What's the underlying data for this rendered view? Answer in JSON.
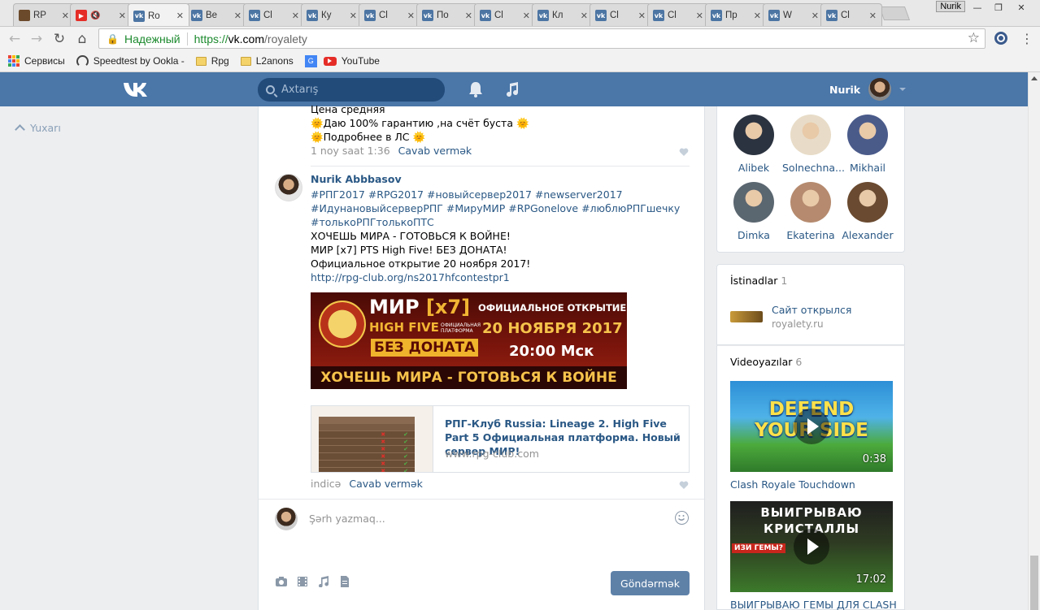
{
  "browser": {
    "tabs": [
      {
        "title": "RP",
        "favicon": "rp"
      },
      {
        "title": "",
        "favicon": "yt",
        "muted": true
      },
      {
        "title": "Ro",
        "favicon": "vk",
        "active": true
      },
      {
        "title": "Be",
        "favicon": "vk"
      },
      {
        "title": "Cl",
        "favicon": "vk"
      },
      {
        "title": "Ку",
        "favicon": "vk"
      },
      {
        "title": "Cl",
        "favicon": "vk"
      },
      {
        "title": "По",
        "favicon": "vk"
      },
      {
        "title": "Cl",
        "favicon": "vk"
      },
      {
        "title": "Кл",
        "favicon": "vk"
      },
      {
        "title": "Cl",
        "favicon": "vk"
      },
      {
        "title": "Cl",
        "favicon": "vk"
      },
      {
        "title": "Пр",
        "favicon": "vk"
      },
      {
        "title": "W",
        "favicon": "vk"
      },
      {
        "title": "Cl",
        "favicon": "vk"
      }
    ],
    "profile_badge": "Nurik",
    "secure_label": "Надежный",
    "url_scheme": "https://",
    "url_host": "vk.com",
    "url_path": "/royalety",
    "bookmarks": [
      {
        "label": "Сервисы",
        "icon": "apps-grid-icon"
      },
      {
        "label": "Speedtest by Ookla - Th",
        "icon": "speedometer-icon"
      },
      {
        "label": "Rpg",
        "icon": "folder-icon"
      },
      {
        "label": "L2anons",
        "icon": "folder-icon"
      },
      {
        "label": "",
        "icon": "google-translate-icon"
      },
      {
        "label": "YouTube",
        "icon": "youtube-icon"
      }
    ]
  },
  "vk": {
    "search_placeholder": "Axtarış",
    "user_name": "Nurik",
    "back_to_top": "Yuxarı"
  },
  "post1": {
    "lines": [
      "Цена средняя",
      "🌞Даю 100% гарантию ,на счёт буста 🌞",
      "🌞Подробнее в ЛС 🌞"
    ],
    "time": "1 noy saat 1:36",
    "reply": "Cavab vermək"
  },
  "post2": {
    "author": "Nurik Abbbasov",
    "hashtags_1": "#РПГ2017 #RPG2017 #новыйсервер2017 #newserver2017",
    "hashtags_2": "#ИдунановыйсерверРПГ #МируМИР #RPGonelove #люблюРПГшечку",
    "hashtags_3": "#толькоРПГтолькоПТС",
    "text_1": "ХОЧЕШЬ МИРА - ГОТОВЬСЯ К ВОЙНЕ!",
    "text_2": "МИР [x7] PTS High Five! БЕЗ ДОНАТА!",
    "text_3": "Официальное открытие 20 ноября 2017!",
    "link": "http://rpg-club.org/ns2017hfcontestpr1",
    "banner": {
      "title_a": "МИР",
      "title_b": "[x7]",
      "sub": "HIGH FIVE",
      "platform": "ОФИЦИАЛЬНАЯ ПЛАТФОРМА",
      "no_donate": "БЕЗ ДОНАТА",
      "opening": "ОФИЦИАЛЬНОЕ ОТКРЫТИЕ",
      "date": "20 НОЯБРЯ 2017",
      "time": "20:00 Мск",
      "bottom": "ХОЧЕШЬ МИРА - ГОТОВЬСЯ К ВОЙНЕ"
    },
    "snippet_title": "РПГ-Клуб Russia: Lineage 2. High Five Part 5 Официальная платформа. Новый сервер МИР!",
    "snippet_domain": "www.rpg-club.com",
    "time": "indicə",
    "reply": "Cavab vermək"
  },
  "composer": {
    "placeholder": "Şərh yazmaq...",
    "send": "Göndərmək"
  },
  "friends": [
    {
      "name": "Alibek",
      "color": "#2b3340"
    },
    {
      "name": "Solnechna...",
      "color": "#e8dcc8"
    },
    {
      "name": "Mikhail",
      "color": "#4a5b8a"
    },
    {
      "name": "Dimka",
      "color": "#5a6670"
    },
    {
      "name": "Ekaterina",
      "color": "#b58a6e"
    },
    {
      "name": "Alexander",
      "color": "#6a4a30"
    }
  ],
  "links_block": {
    "heading": "İstinadlar",
    "count": "1",
    "title": "Сайт открылся",
    "domain": "royalety.ru"
  },
  "videos_block": {
    "heading": "Videoyazılar",
    "count": "6",
    "items": [
      {
        "title": "Clash Royale Touchdown",
        "duration": "0:38",
        "thumb_text": "DEFEND YOUR SIDE"
      },
      {
        "title": "ВЫИГРЫВАЮ ГЕМЫ ДЛЯ CLASH",
        "duration": "17:02",
        "thumb_text": "ВЫИГРЫВАЮ КРИСТАЛЛЫ",
        "thumb_badge": "ИЗИ ГЕМЫ?"
      }
    ]
  },
  "colors": {
    "vk_blue": "#4a76a8",
    "link_blue": "#2a5885",
    "secure_green": "#1c8a2e"
  }
}
